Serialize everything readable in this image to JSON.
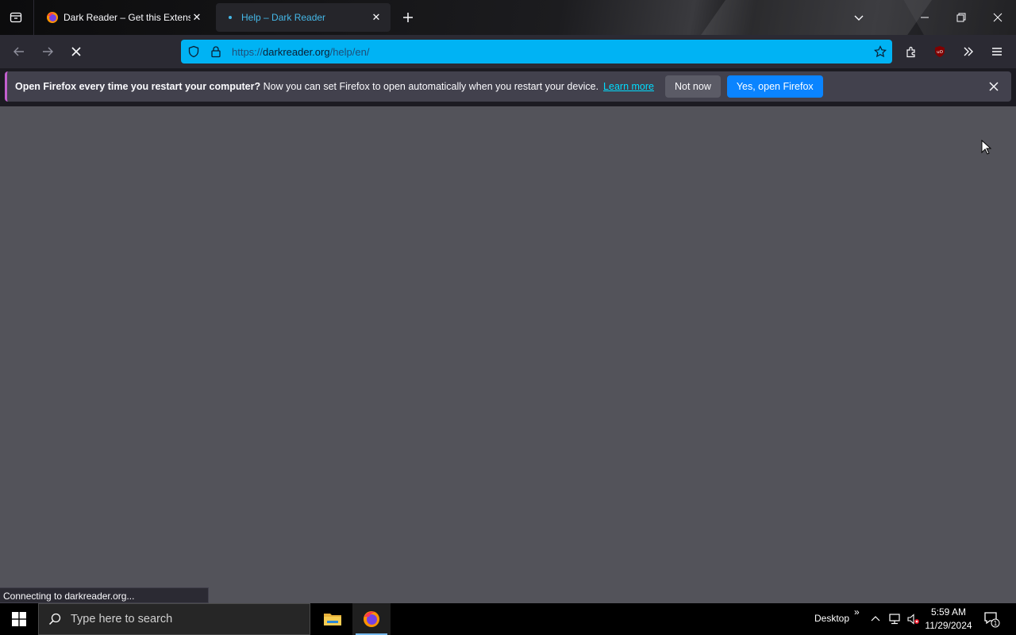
{
  "browser": {
    "tabs": [
      {
        "title": "Dark Reader – Get this Extension for Firefox",
        "active": false
      },
      {
        "title": "Help – Dark Reader",
        "active": true
      }
    ],
    "url": {
      "scheme": "https://",
      "host": "darkreader.org",
      "path": "/help/en/"
    },
    "toolbar_icons": [
      "back-icon",
      "forward-icon",
      "stop-icon",
      "shield-icon",
      "lock-icon",
      "bookmark-star-icon",
      "extensions-icon",
      "ublock-icon",
      "overflow-chevrons-icon",
      "menu-icon"
    ]
  },
  "notification": {
    "bold": "Open Firefox every time you restart your computer?",
    "message": "Now you can set Firefox to open automatically when you restart your device.",
    "link": "Learn more",
    "secondary_button": "Not now",
    "primary_button": "Yes, open Firefox"
  },
  "status": {
    "text": "Connecting to darkreader.org..."
  },
  "taskbar": {
    "search_placeholder": "Type here to search",
    "desktop_label": "Desktop",
    "time": "5:59 AM",
    "date": "11/29/2024",
    "notification_count": "1"
  },
  "colors": {
    "urlbar": "#00b3f4",
    "content_bg": "#53535a",
    "primary_button": "#0a84ff",
    "active_tab_text": "#45b8e8"
  }
}
